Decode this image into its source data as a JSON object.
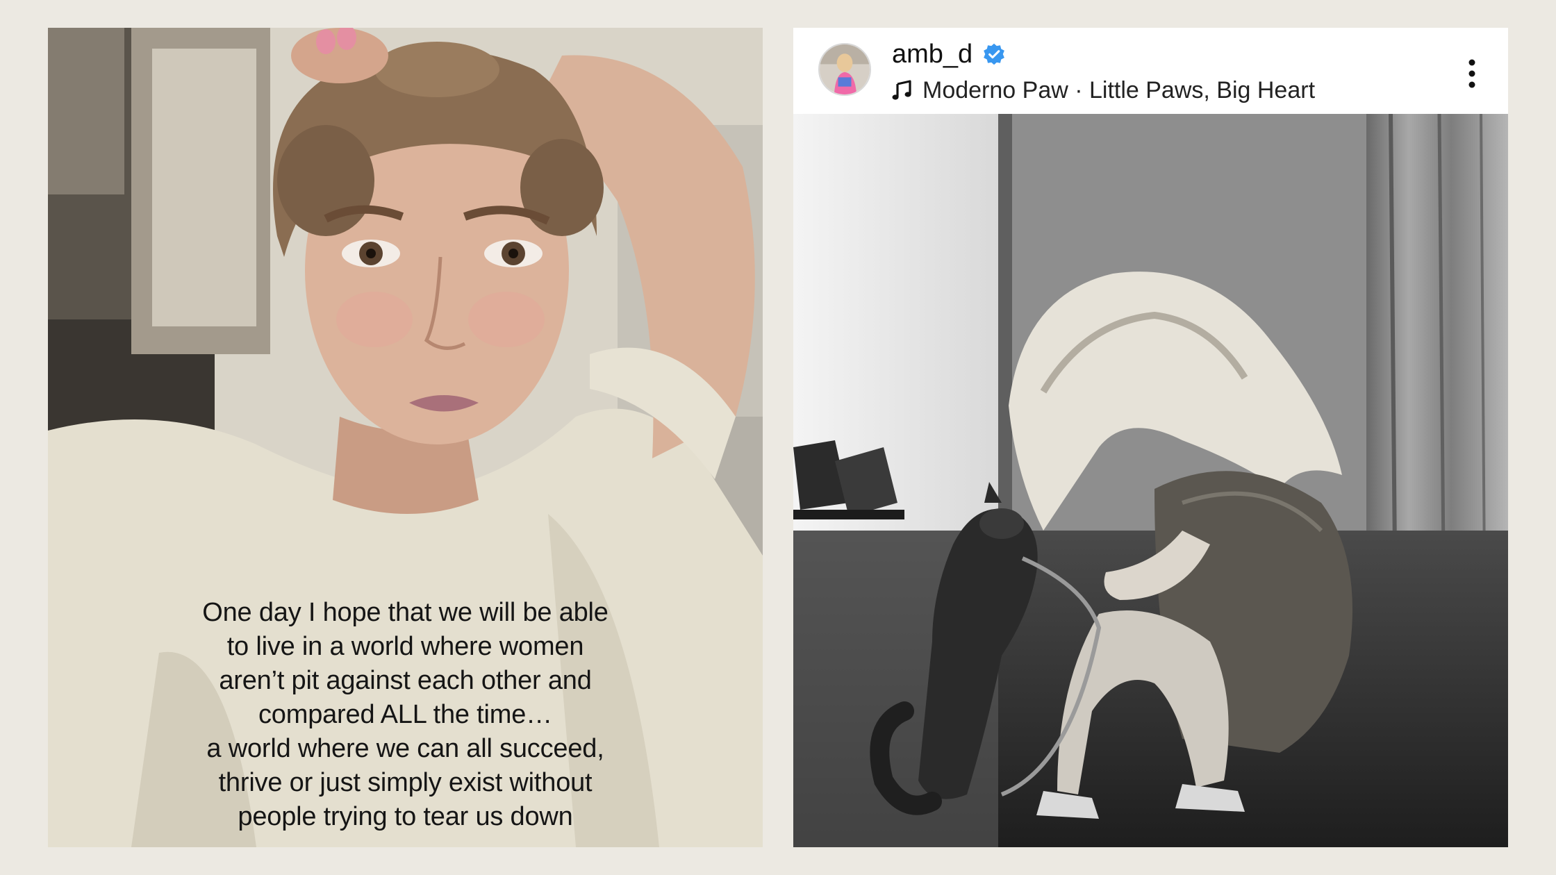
{
  "video": {
    "caption": "One day I hope that we will be able\nto live in a world where women\naren’t pit against each other and\ncompared ALL the time…\na world where we can all succeed,\nthrive or just simply exist without\npeople trying to tear us down"
  },
  "post": {
    "username": "amb_d",
    "verified": true,
    "music_label": "Moderno Paw · Little Paws, Big Heart",
    "icons": {
      "verified": "verified-badge-icon",
      "music": "music-note-icon",
      "more": "more-vertical-icon"
    },
    "colors": {
      "verified": "#3897f0",
      "text": "#111111"
    }
  }
}
